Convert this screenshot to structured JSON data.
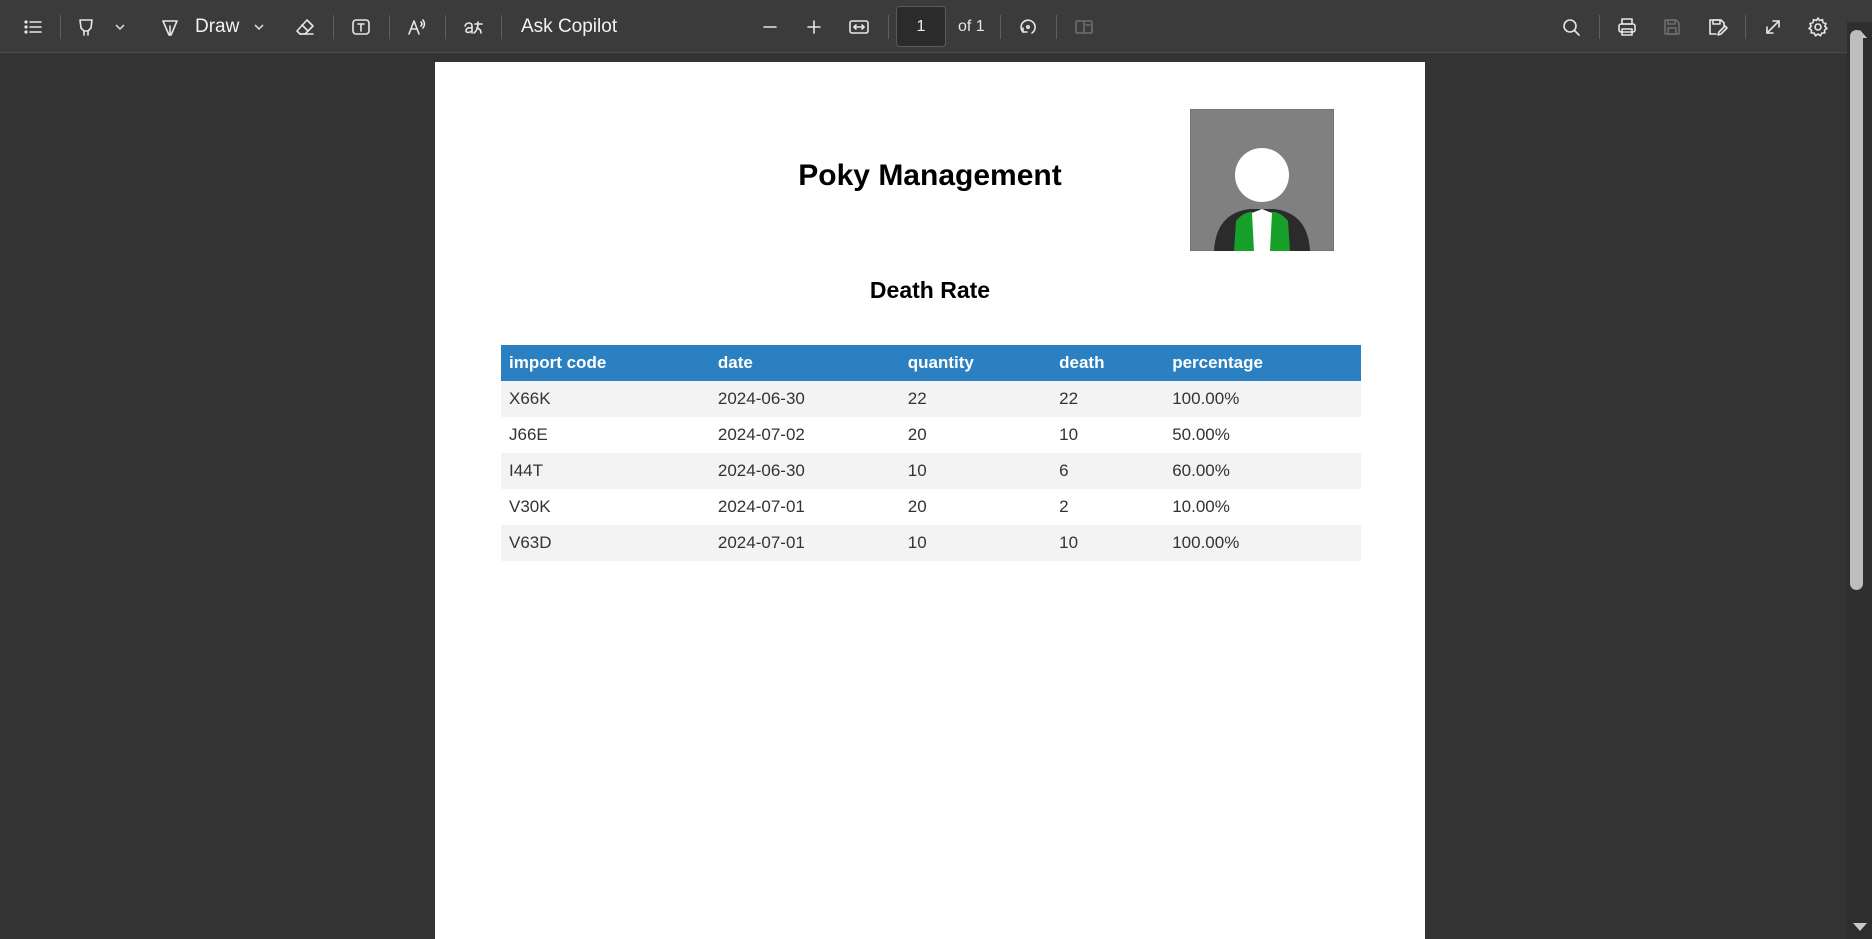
{
  "toolbar": {
    "draw_label": "Draw",
    "ask_copilot_label": "Ask Copilot",
    "page_number": "1",
    "page_of": "of 1"
  },
  "document": {
    "title": "Poky Management",
    "subtitle": "Death Rate",
    "table": {
      "headers": [
        "import code",
        "date",
        "quantity",
        "death",
        "percentage"
      ],
      "rows": [
        [
          "X66K",
          "2024-06-30",
          "22",
          "22",
          "100.00%"
        ],
        [
          "J66E",
          "2024-07-02",
          "20",
          "10",
          "50.00%"
        ],
        [
          "I44T",
          "2024-06-30",
          "10",
          "6",
          "60.00%"
        ],
        [
          "V30K",
          "2024-07-01",
          "20",
          "2",
          "10.00%"
        ],
        [
          "V63D",
          "2024-07-01",
          "10",
          "10",
          "100.00%"
        ]
      ]
    }
  },
  "colors": {
    "table_header": "#2a80c0",
    "toolbar_bg": "#3b3b3b",
    "viewer_bg": "#333333"
  },
  "icons": {
    "contents": "list-icon",
    "highlight": "highlighter-icon",
    "draw": "pen-icon",
    "erase": "eraser-icon",
    "text": "text-box-icon",
    "read_aloud": "read-aloud-icon",
    "translate": "translate-icon",
    "zoom_out": "minus-icon",
    "zoom_in": "plus-icon",
    "fit": "fit-width-icon",
    "rotate": "rotate-icon",
    "two_page": "page-view-icon",
    "search": "search-icon",
    "print": "print-icon",
    "save": "save-icon",
    "save_as": "save-as-icon",
    "fullscreen": "expand-icon",
    "settings": "gear-icon"
  }
}
